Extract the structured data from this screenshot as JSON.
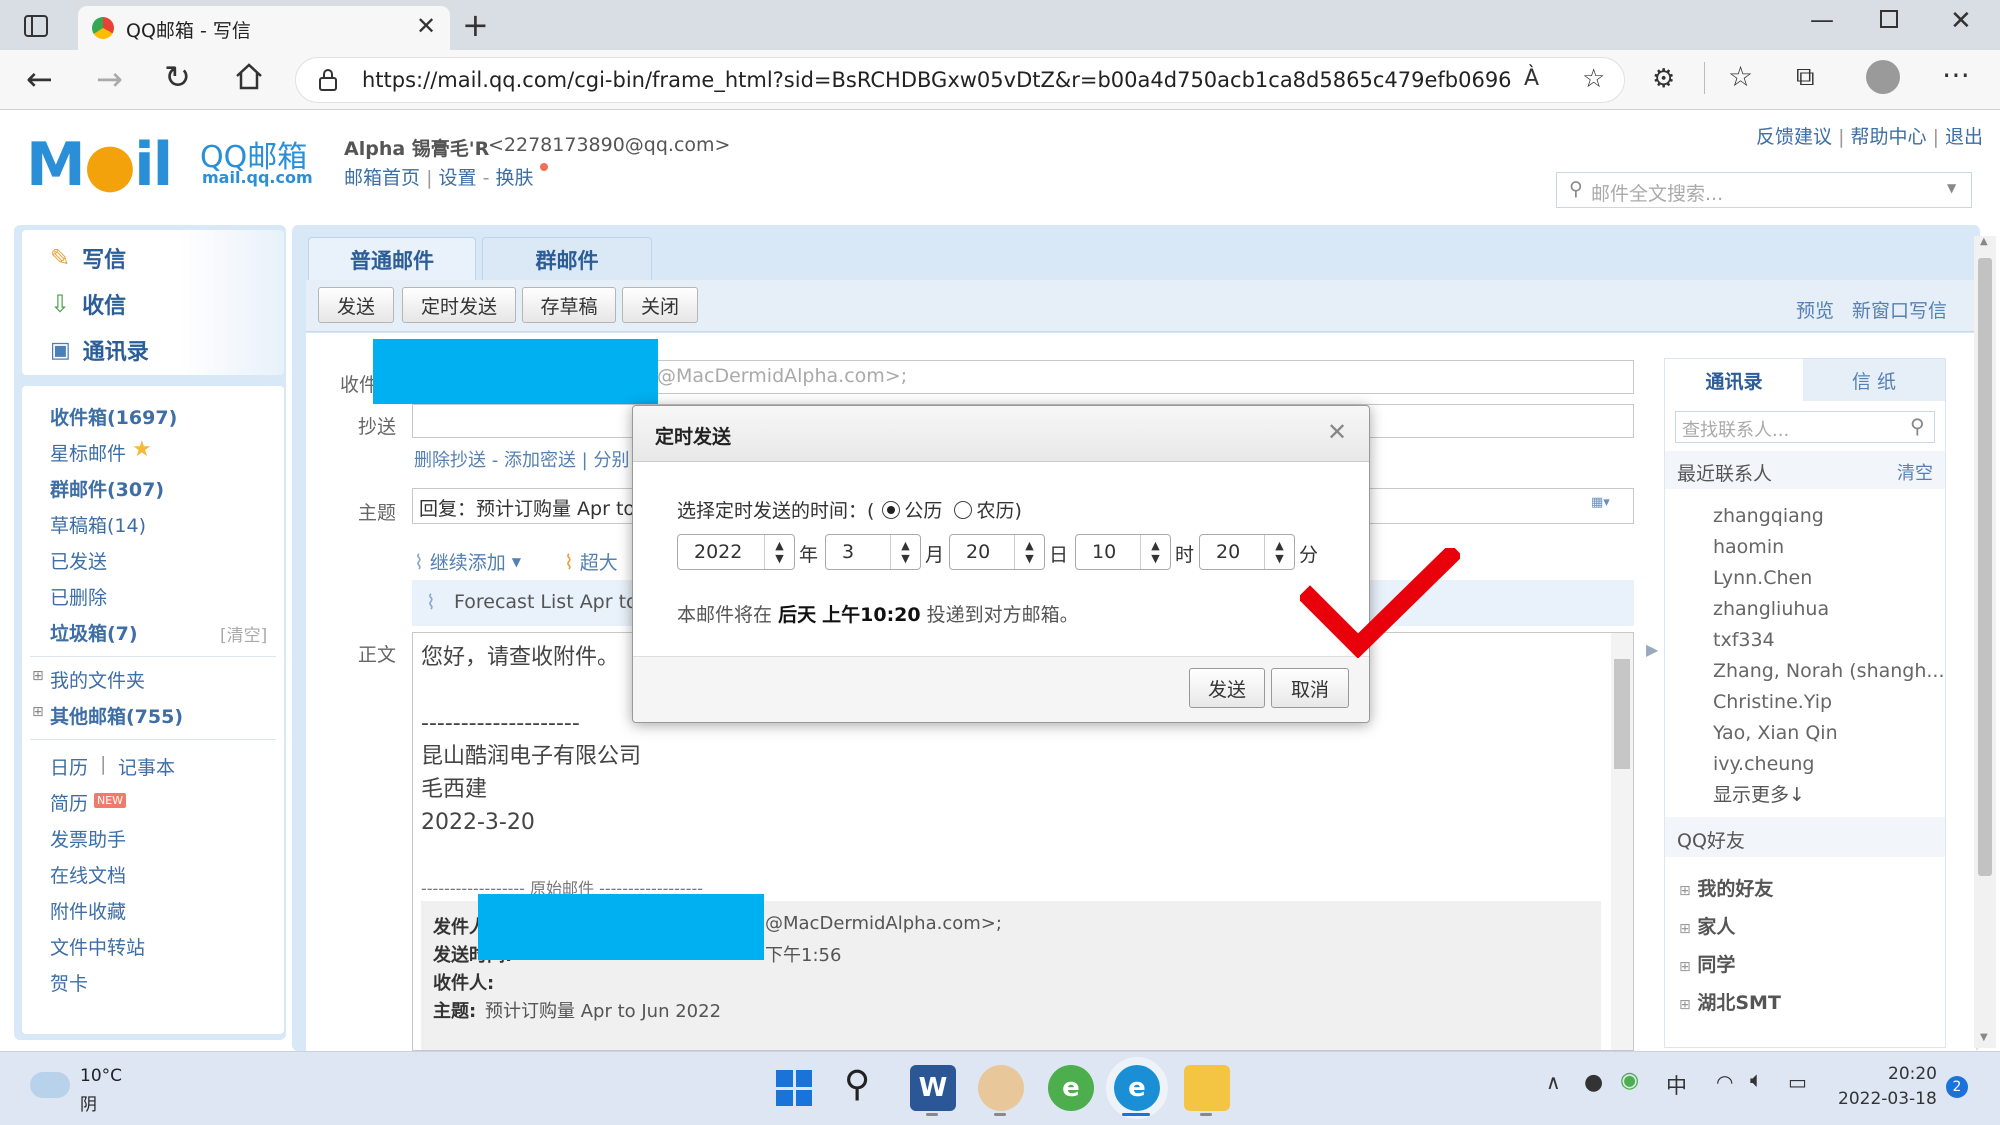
{
  "browser": {
    "tab_title": "QQ邮箱 - 写信",
    "url": "https://mail.qq.com/cgi-bin/frame_html?sid=BsRCHDBGxw05vDtZ&r=b00a4d750acb1ca8d5865c479efb0696",
    "read_aloud": "À"
  },
  "header": {
    "logo_main": "QQ邮箱",
    "logo_sub": "mail.qq.com",
    "user_name": "Alpha 锡膏毛'R",
    "user_email": "<2278173890@qq.com>",
    "home_link": "邮箱首页",
    "settings_link": "设置",
    "skin_link": "换肤",
    "feedback": "反馈建议",
    "help": "帮助中心",
    "logout": "退出",
    "search_placeholder": "邮件全文搜索..."
  },
  "sidebar": {
    "compose": "写信",
    "inbox": "收信",
    "contacts": "通讯录",
    "folders": [
      {
        "label": "收件箱(1697)",
        "bold": true
      },
      {
        "label": "星标邮件",
        "bold": false
      },
      {
        "label": "群邮件(307)",
        "bold": true
      },
      {
        "label": "草稿箱(14)",
        "bold": false
      },
      {
        "label": "已发送",
        "bold": false
      },
      {
        "label": "已删除",
        "bold": false
      },
      {
        "label": "垃圾箱(7)",
        "bold": true
      }
    ],
    "trash_clear": "[清空]",
    "my_folders": "我的文件夹",
    "other_mail": "其他邮箱(755)",
    "calendar": "日历",
    "notebook": "记事本",
    "resume": "简历",
    "new_badge": "NEW",
    "tools": [
      "发票助手",
      "在线文档",
      "附件收藏",
      "文件中转站",
      "贺卡"
    ]
  },
  "compose": {
    "tab_normal": "普通邮件",
    "tab_group": "群邮件",
    "btn_send": "发送",
    "btn_schedule": "定时发送",
    "btn_draft": "存草稿",
    "btn_close": "关闭",
    "preview": "预览",
    "new_window": "新窗口写信",
    "to_label": "收件人",
    "to_value": "@MacDermidAlpha.com>;",
    "cc_label": "抄送",
    "cc_links": "删除抄送 - 添加密送 | 分别",
    "subject_label": "主题",
    "subject_value": "回复：预计订购量 Apr to",
    "attach_continue": "继续添加",
    "attach_large": "超大",
    "attachment_name": "Forecast List Apr to",
    "body_label": "正文",
    "body_lines": [
      "您好，请查收附件。",
      "",
      "--------------------",
      "昆山酷润电子有限公司",
      "毛西建",
      "2022-3-20"
    ],
    "orig_header": "------------------ 原始邮件 ------------------",
    "orig_from_label": "发件人:",
    "orig_from_value": "@MacDermidAlpha.com>;",
    "orig_time_label": "发送时间:",
    "orig_time_value": "下午1:56",
    "orig_to_label": "收件人:",
    "orig_subject_label": "主题:",
    "orig_subject_value": "预计订购量 Apr to Jun 2022"
  },
  "dialog": {
    "title": "定时发送",
    "prompt": "选择定时发送的时间：(",
    "solar": "公历",
    "lunar": "农历)",
    "year": "2022",
    "year_unit": "年",
    "month": "3",
    "month_unit": "月",
    "day": "20",
    "day_unit": "日",
    "hour": "10",
    "hour_unit": "时",
    "minute": "20",
    "minute_unit": "分",
    "notice_prefix": "本邮件将在",
    "notice_day": "后天",
    "notice_time": "上午10:20",
    "notice_suffix": "投递到对方邮箱。",
    "send": "发送",
    "cancel": "取消"
  },
  "contacts_panel": {
    "tab_contacts": "通讯录",
    "tab_paper": "信 纸",
    "search_placeholder": "查找联系人...",
    "recent_label": "最近联系人",
    "clear": "清空",
    "recent": [
      "zhangqiang",
      "haomin",
      "Lynn.Chen",
      "zhangliuhua",
      "txf334",
      "Zhang, Norah (shangh...",
      "Christine.Yip",
      "Yao, Xian Qin",
      "ivy.cheung"
    ],
    "more": "显示更多↓",
    "qq_friends": "QQ好友",
    "groups": [
      "我的好友",
      "家人",
      "同学",
      "湖北SMT"
    ]
  },
  "taskbar": {
    "temp": "10°C",
    "weather": "阴",
    "ime": "中",
    "time": "20:20",
    "date": "2022-03-18",
    "notif_count": "2"
  },
  "colors": {
    "accent": "#3d6ea6",
    "sidebar_bg": "#d8e8f6",
    "redaction": "#00b0f0",
    "checkmark": "#e8000a"
  }
}
